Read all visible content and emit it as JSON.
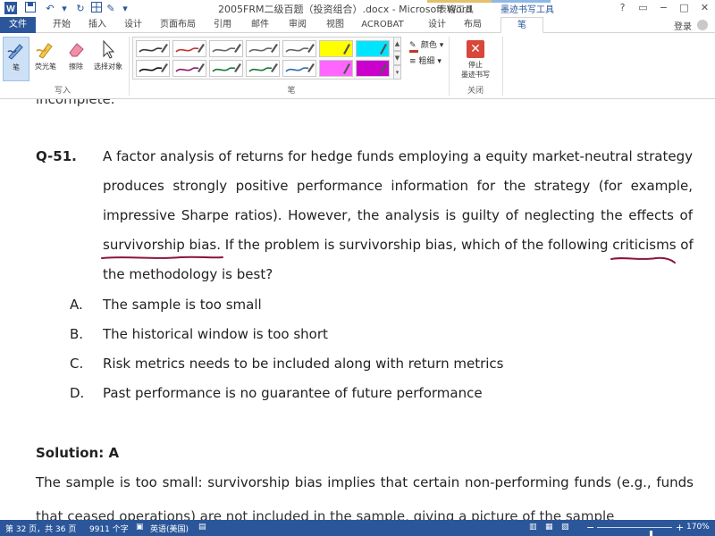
{
  "titlebar": {
    "title": "2005FRM二级百题（投资组合）.docx - Microsoft Word",
    "context_table": "表格工具",
    "context_ink": "墨迹书写工具",
    "window_controls": [
      "?",
      "▭",
      "−",
      "□",
      "✕"
    ]
  },
  "tabs": [
    {
      "label": "文件"
    },
    {
      "label": "开始"
    },
    {
      "label": "插入"
    },
    {
      "label": "设计"
    },
    {
      "label": "页面布局"
    },
    {
      "label": "引用"
    },
    {
      "label": "邮件"
    },
    {
      "label": "审阅"
    },
    {
      "label": "视图"
    },
    {
      "label": "ACROBAT"
    },
    {
      "label": "设计"
    },
    {
      "label": "布局"
    },
    {
      "label": "笔"
    }
  ],
  "user": {
    "login": "登录"
  },
  "ribbon": {
    "write_group": {
      "label": "写入",
      "buttons": [
        {
          "label": "笔",
          "icon": "pen-icon"
        },
        {
          "label": "荧光笔",
          "icon": "highlighter-icon"
        },
        {
          "label": "擦除",
          "icon": "eraser-icon"
        },
        {
          "label": "选择对象",
          "icon": "select-arrow-icon"
        }
      ]
    },
    "pens_group": {
      "label": "笔",
      "color_label": "颜色",
      "thickness_label": "粗细",
      "swatches_row1": [
        "#3a3a3a",
        "#c0392b",
        "#666666",
        "#666666",
        "#666666",
        "#ffff00",
        "#00e5ff"
      ],
      "swatches_row2": [
        "#111111",
        "#8e1b6e",
        "#1a7a3a",
        "#1a7a3a",
        "#2a6fb0",
        "#ff66ff",
        "#cc00cc"
      ]
    },
    "close_group": {
      "label": "关闭",
      "stop_label_1": "停止",
      "stop_label_2": "墨迹书写"
    }
  },
  "document": {
    "prev_fragment": "incomplete.",
    "question_number": "Q-51.",
    "question_lines": [
      "A factor analysis of returns for hedge funds employing a equity market-neutral strategy",
      "produces strongly positive performance information for the strategy (for example,",
      "impressive Sharpe ratios). However, the analysis is guilty of neglecting the effects of",
      "survivorship bias. If the problem is survivorship bias, which of the following criticisms of",
      "the methodology is best?"
    ],
    "choices": [
      {
        "letter": "A.",
        "text": "The sample is too small"
      },
      {
        "letter": "B.",
        "text": "The historical window is too short"
      },
      {
        "letter": "C.",
        "text": "Risk metrics needs to be included along with return metrics"
      },
      {
        "letter": "D.",
        "text": "Past performance is no guarantee of future performance"
      }
    ],
    "solution_heading": "Solution: A",
    "solution_line_1": "The sample is too small: survivorship bias implies that certain non-performing funds (e.g., funds",
    "solution_line_2_fragment": "that ceased operations) are not included in the sample, giving a picture of the sample",
    "ink_color": "#8b1538"
  },
  "statusbar": {
    "page": "第 32 页，共 36 页",
    "words": "9911 个字",
    "language": "英语(美国)",
    "zoom": "170%",
    "zoom_fraction": 0.72
  }
}
